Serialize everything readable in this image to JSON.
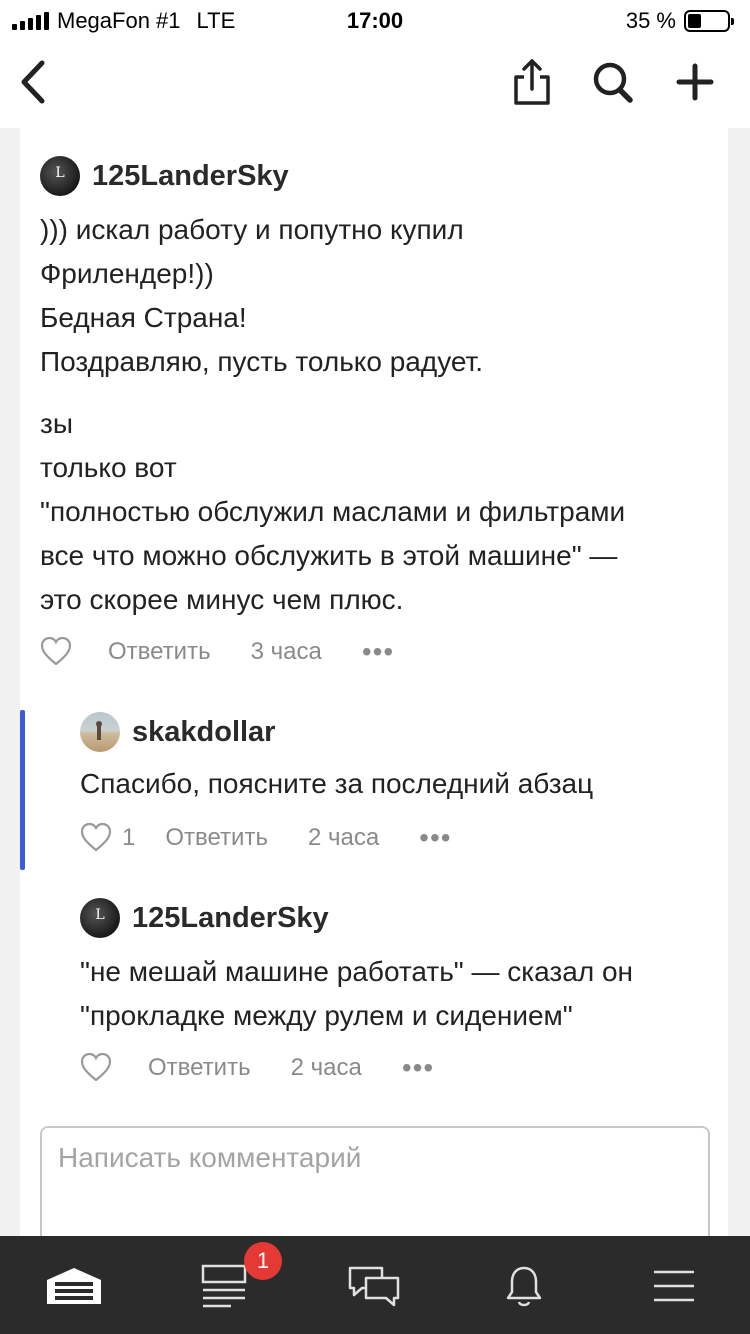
{
  "status_bar": {
    "carrier": "MegaFon #1",
    "network": "LTE",
    "time": "17:00",
    "battery": "35 %",
    "battery_level": 0.35
  },
  "navbar": {
    "icons": [
      "back-icon",
      "share-icon",
      "search-icon",
      "plus-icon"
    ]
  },
  "comments": [
    {
      "author": "125LanderSky",
      "paragraphs": [
        [
          "))) искал работу и попутно купил",
          "Фрилендер!))",
          "Бедная Страна!",
          "Поздравляю, пусть только радует."
        ],
        [
          "зы",
          "только вот",
          "\"полностью обслужил маслами и фильтрами",
          "все что можно обслужить в этой машине\" —",
          "это скорее минус чем плюс."
        ]
      ],
      "likes": "",
      "reply": "Ответить",
      "time": "3 часа"
    },
    {
      "author": "skakdollar",
      "paragraphs": [
        [
          "Спасибо, поясните за последний абзац"
        ]
      ],
      "likes": "1",
      "reply": "Ответить",
      "time": "2 часа"
    },
    {
      "author": "125LanderSky",
      "paragraphs": [
        [
          "\"не мешай машине работать\" — сказал он",
          "\"прокладке между рулем и сидением\""
        ]
      ],
      "likes": "",
      "reply": "Ответить",
      "time": "2 часа"
    }
  ],
  "comment_input": {
    "placeholder": "Написать комментарий",
    "value": ""
  },
  "tabbar": {
    "tabs": [
      "garage-icon",
      "feed-icon",
      "messages-icon",
      "bell-icon",
      "menu-icon"
    ],
    "badge": "1"
  },
  "colors": {
    "thread_accent": "#3b5bdb",
    "badge": "#e53935",
    "tabbar_bg": "#2b2b2b"
  }
}
